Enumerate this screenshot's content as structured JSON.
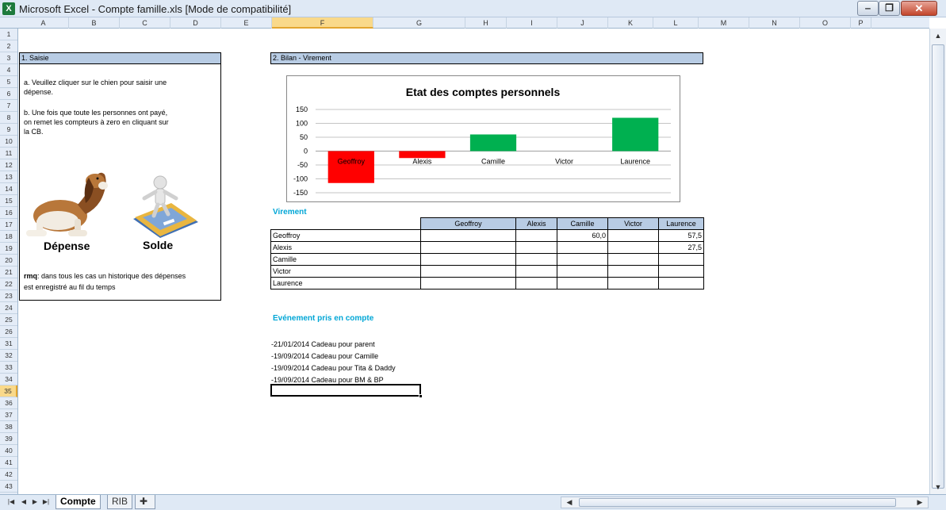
{
  "window": {
    "title": "Microsoft Excel - Compte famille.xls  [Mode de compatibilité]",
    "app_icon": "excel-icon",
    "buttons": {
      "minimize": "‒",
      "maximize": "❐",
      "close": "✕"
    }
  },
  "columns": [
    "A",
    "B",
    "C",
    "D",
    "E",
    "F",
    "G",
    "H",
    "I",
    "J",
    "K",
    "L",
    "M",
    "N",
    "O",
    "P"
  ],
  "active_column": "F",
  "rows": [
    "1",
    "2",
    "3",
    "4",
    "5",
    "6",
    "7",
    "8",
    "9",
    "10",
    "11",
    "12",
    "13",
    "14",
    "15",
    "16",
    "17",
    "18",
    "19",
    "20",
    "21",
    "22",
    "23",
    "24",
    "25",
    "26",
    "31",
    "32",
    "33",
    "34",
    "35",
    "36",
    "37",
    "38",
    "39",
    "40",
    "41",
    "42",
    "43"
  ],
  "active_row": "35",
  "saisie": {
    "header": "1. Saisie",
    "line_a1": "a. Veuillez cliquer sur le chien pour saisir une",
    "line_a2": "dépense.",
    "line_b1": "b. Une fois que toute les personnes ont payé,",
    "line_b2": "on remet  les compteurs à zero  en cliquant sur",
    "line_b3": "la CB.",
    "depense_label": "Dépense",
    "solde_label": "Solde",
    "rmq_bold": "rmq",
    "rmq_rest": ": dans tous les cas un historique des dépenses",
    "rmq_line2": "est enregistré au fil du temps"
  },
  "bilan": {
    "header": "2. Bilan -  Virement"
  },
  "chart_data": {
    "type": "bar",
    "title": "Etat des comptes personnels",
    "categories": [
      "Geoffroy",
      "Alexis",
      "Camille",
      "Victor",
      "Laurence"
    ],
    "values": [
      -115,
      -25,
      60,
      0,
      120
    ],
    "ylim": [
      -150,
      150
    ],
    "yticks": [
      "150",
      "100",
      "50",
      "0",
      "-50",
      "-100",
      "-150"
    ],
    "ytick_values": [
      150,
      100,
      50,
      0,
      -50,
      -100,
      -150
    ],
    "grid": true,
    "colors": {
      "negative": "#ff0000",
      "positive": "#00b050"
    }
  },
  "virement": {
    "title": "Virement",
    "columns": [
      "Geoffroy",
      "Alexis",
      "Camille",
      "Victor",
      "Laurence"
    ],
    "rows": [
      {
        "name": "Geoffroy",
        "cells": [
          "",
          "",
          "60,0",
          "",
          "57,5"
        ]
      },
      {
        "name": "Alexis",
        "cells": [
          "",
          "",
          "",
          "",
          "27,5"
        ]
      },
      {
        "name": "Camille",
        "cells": [
          "",
          "",
          "",
          "",
          ""
        ]
      },
      {
        "name": "Victor",
        "cells": [
          "",
          "",
          "",
          "",
          ""
        ]
      },
      {
        "name": "Laurence",
        "cells": [
          "",
          "",
          "",
          "",
          ""
        ]
      }
    ]
  },
  "evenements": {
    "title": "Evénement pris en compte",
    "lines": [
      "-21/01/2014  Cadeau pour  parent",
      "-19/09/2014  Cadeau pour  Camille",
      "-19/09/2014  Cadeau pour  Tita & Daddy",
      "-19/09/2014  Cadeau pour  BM & BP"
    ]
  },
  "sheets": {
    "tabs": [
      "Compte",
      "RIB"
    ],
    "active": "Compte"
  }
}
